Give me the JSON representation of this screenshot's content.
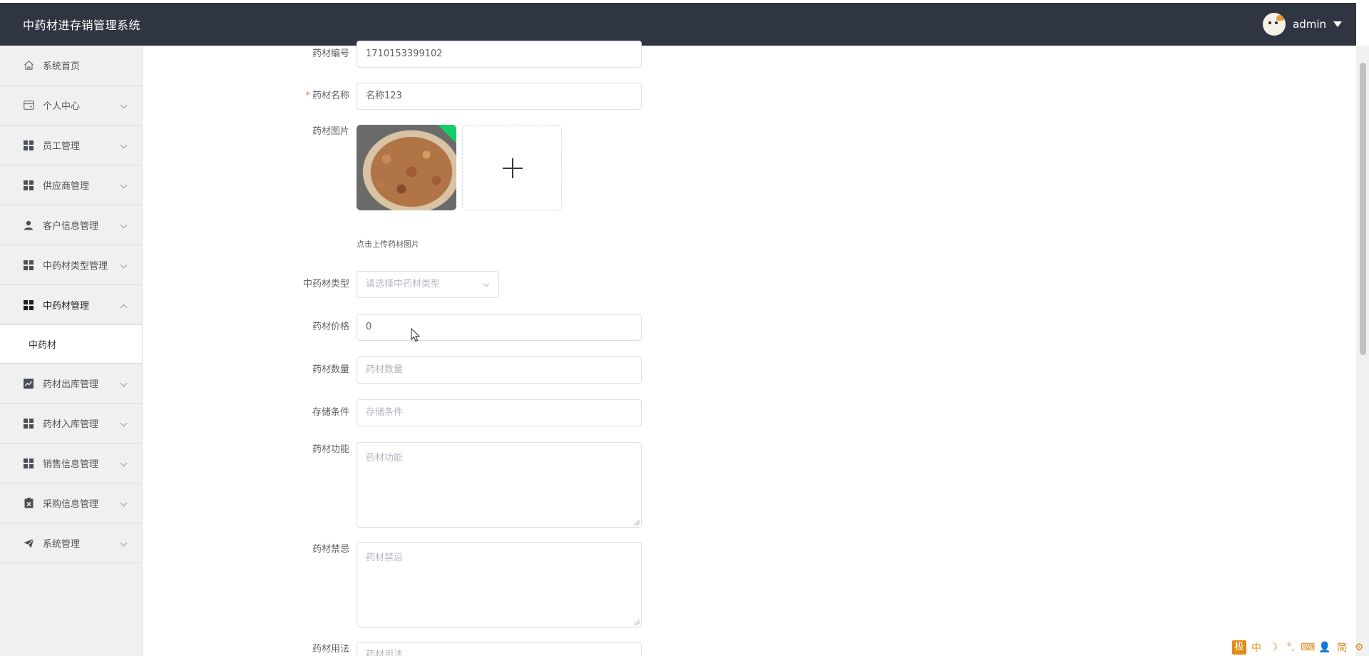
{
  "header": {
    "app_title": "中药材进存销管理系统",
    "user_name": "admin"
  },
  "sidebar": {
    "items": [
      {
        "label": "系统首页",
        "icon": "home-icon"
      },
      {
        "label": "个人中心",
        "icon": "card-icon"
      },
      {
        "label": "员工管理",
        "icon": "grid-icon"
      },
      {
        "label": "供应商管理",
        "icon": "grid-icon"
      },
      {
        "label": "客户信息管理",
        "icon": "person-icon"
      },
      {
        "label": "中药材类型管理",
        "icon": "grid-icon"
      },
      {
        "label": "中药材管理",
        "icon": "grid-icon",
        "expanded": true
      },
      {
        "label": "药材出库管理",
        "icon": "chart-icon"
      },
      {
        "label": "药材入库管理",
        "icon": "grid-icon"
      },
      {
        "label": "销售信息管理",
        "icon": "grid-icon"
      },
      {
        "label": "采购信息管理",
        "icon": "clipboard-icon"
      },
      {
        "label": "系统管理",
        "icon": "send-icon"
      }
    ],
    "sub_item": "中药材"
  },
  "form": {
    "code": {
      "label": "药材编号",
      "value": "1710153399102"
    },
    "name": {
      "label": "药材名称",
      "value": "名称123",
      "required": true
    },
    "image": {
      "label": "药材图片",
      "tip": "点击上传药材图片"
    },
    "type": {
      "label": "中药材类型",
      "placeholder": "请选择中药材类型"
    },
    "price": {
      "label": "药材价格",
      "value": "0"
    },
    "quantity": {
      "label": "药材数量",
      "placeholder": "药材数量"
    },
    "storage": {
      "label": "存储条件",
      "placeholder": "存储条件"
    },
    "function": {
      "label": "药材功能",
      "placeholder": "药材功能"
    },
    "taboo": {
      "label": "药材禁忌",
      "placeholder": "药材禁忌"
    },
    "usage": {
      "label": "药材用法",
      "placeholder": "药材用法"
    }
  },
  "ime_tray": {
    "logo": "极",
    "items": [
      "中",
      "☽",
      "°,",
      "⌨",
      "👤",
      "简",
      "⚙"
    ]
  },
  "colors": {
    "header_bg": "#2f3642",
    "sidebar_bg": "#f0f0f0",
    "required": "#f56c6c",
    "accent": "#13ce66"
  }
}
